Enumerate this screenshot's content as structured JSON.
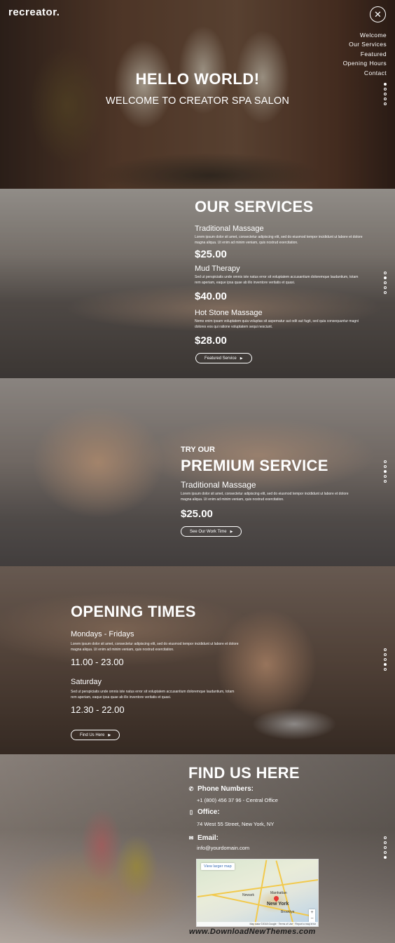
{
  "brand": {
    "logo": "recreator."
  },
  "nav": [
    "Welcome",
    "Our Services",
    "Featured",
    "Opening Hours",
    "Contact"
  ],
  "hero": {
    "title": "HELLO WORLD!",
    "subtitle": "WELCOME TO CREATOR SPA SALON"
  },
  "services": {
    "title": "OUR SERVICES",
    "items": [
      {
        "name": "Traditional Massage",
        "desc": "Lorem ipsum dolor sit amet, consectetur adipiscing elit, sed do eiusmod tempor incididunt ut labore et dolore magna aliqua. Ut enim ad minim veniam, quis nostrud exercitation.",
        "price": "$25.00"
      },
      {
        "name": "Mud Therapy",
        "desc": "Sed ut perspiciatis unde omnis iste natus error sit voluptatem accusantium doloremque laudantium, totam rem aperiam, eaque ipsa quae ab illo inventore veritatis et quasi.",
        "price": "$40.00"
      },
      {
        "name": "Hot Stone Massage",
        "desc": "Nemo enim ipsam voluptatem quia voluptas sit aspernatur aut odit aut fugit, sed quia consequuntur magni dolores eos qui ratione voluptatem sequi nesciunt.",
        "price": "$28.00"
      }
    ],
    "button": "Featured Service"
  },
  "premium": {
    "kicker": "TRY OUR",
    "title": "PREMIUM SERVICE",
    "item": "Traditional Massage",
    "desc": "Lorem ipsum dolor sit amet, consectetur adipiscing elit, sed do eiusmod tempor incididunt ut labore et dolore magna aliqua. Ut enim ad minim veniam, quis nostrud exercitation.",
    "price": "$25.00",
    "button": "See Our Work Time"
  },
  "hours": {
    "title": "OPENING TIMES",
    "weekday": {
      "label": "Mondays - Fridays",
      "desc": "Lorem ipsum dolor sit amet, consectetur adipiscing elit, sed do eiusmod tempor incididunt ut labore et dolore magna aliqua. Ut enim ad minim veniam, quis nostrud exercitation.",
      "time": "11.00 - 23.00"
    },
    "saturday": {
      "label": "Saturday",
      "desc": "Sed ut perspiciatis unde omnis iste natus error sit voluptatem accusantium doloremque laudantium, totam rem aperiam, eaque ipsa quae ab illo inventore veritatis et quasi.",
      "time": "12.30 - 22.00"
    },
    "button": "Find Us Here"
  },
  "find": {
    "title": "FIND US HERE",
    "phone_label": "Phone Numbers:",
    "phone": "+1 (800) 456 37 96 - Central Office",
    "office_label": "Office:",
    "office": "74 West 55 Street, New York, NY",
    "email_label": "Email:",
    "email": "info@yourdomain.com",
    "map": {
      "button": "View larger map",
      "city": "New York",
      "place1": "Newark",
      "place2": "Manhattan",
      "place3": "Brooklyn",
      "footer": "Map data ©2018 Google · Terms of Use · Report a map error"
    }
  },
  "watermark": "www.DownloadNewThemes.com",
  "colors": {
    "accent": "#ffffff",
    "overlay": "#000000"
  }
}
